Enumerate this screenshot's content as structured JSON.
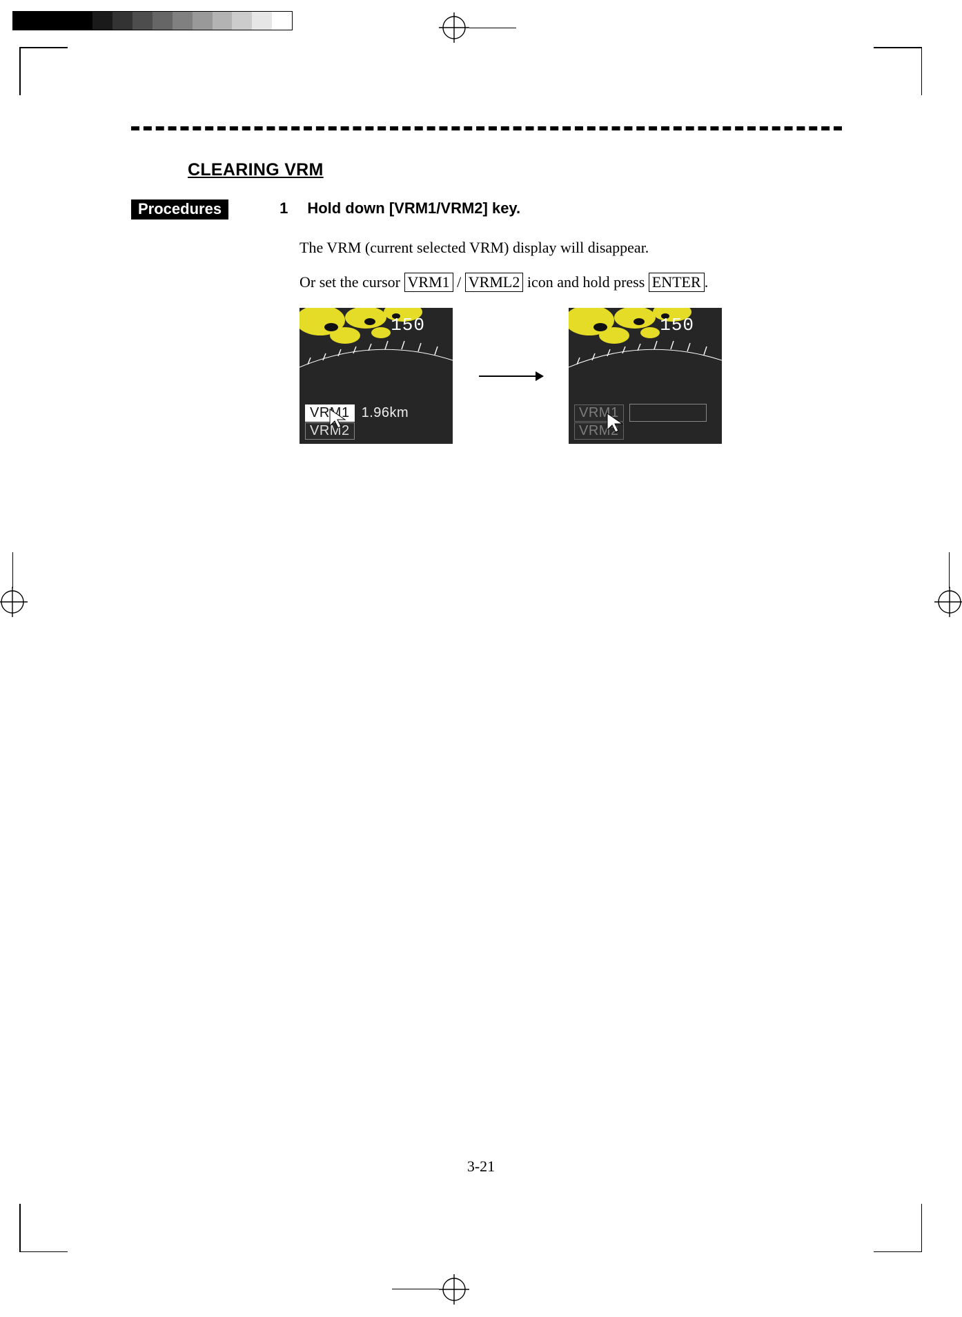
{
  "section_title": "CLEARING VRM",
  "badge": "Procedures",
  "step_number": "1",
  "step_text": "Hold down [VRM1/VRM2] key.",
  "body_line_1": "The VRM (current selected VRM) display will disappear.",
  "body_line_2_prefix": "Or set the cursor ",
  "boxed_1": "VRM1",
  "boxed_sep": " / ",
  "boxed_2": "VRML2",
  "body_line_2_mid": " icon and hold press ",
  "boxed_3": "ENTER",
  "body_line_2_end": ".",
  "shots": {
    "bearing": "150",
    "left": {
      "tag1": "VRM1",
      "value": "1.96km",
      "tag2": "VRM2"
    },
    "right": {
      "tag1": "VRM1",
      "tag2": "VRM2"
    }
  },
  "page_number": "3-21",
  "cal_swatches": [
    "#000000",
    "#000000",
    "#000000",
    "#000000",
    "#1a1a1a",
    "#333333",
    "#4d4d4d",
    "#666666",
    "#808080",
    "#999999",
    "#b3b3b3",
    "#cccccc",
    "#e6e6e6",
    "#ffffff"
  ]
}
